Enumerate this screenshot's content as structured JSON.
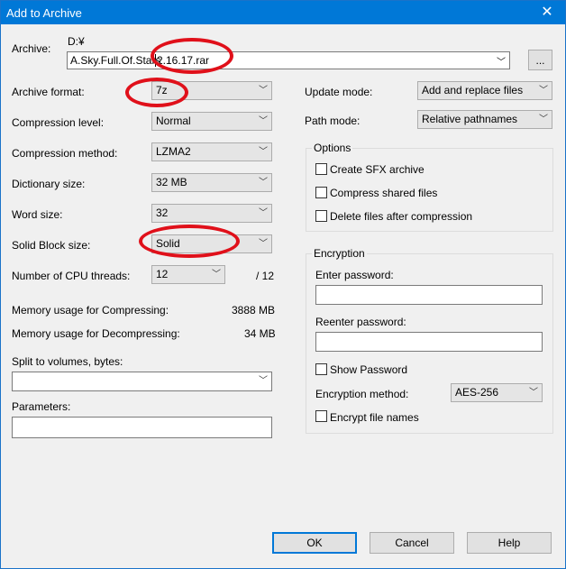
{
  "window": {
    "title": "Add to Archive"
  },
  "archive": {
    "label": "Archive:",
    "dir": "D:¥",
    "name_part1": "A.Sky.Full.Of.Stars",
    "name_part2": "2.16.17.rar",
    "browse_label": "..."
  },
  "left": {
    "format": {
      "label": "Archive format:",
      "value": "7z"
    },
    "level": {
      "label": "Compression level:",
      "value": "Normal"
    },
    "method": {
      "label": "Compression method:",
      "value": "LZMA2"
    },
    "dict": {
      "label": "Dictionary size:",
      "value": "32 MB"
    },
    "word": {
      "label": "Word size:",
      "value": "32"
    },
    "solid": {
      "label": "Solid Block size:",
      "value": "Solid"
    },
    "threads": {
      "label": "Number of CPU threads:",
      "value": "12",
      "max": "/ 12"
    },
    "mem_comp": {
      "label": "Memory usage for Compressing:",
      "value": "3888 MB"
    },
    "mem_decomp": {
      "label": "Memory usage for Decompressing:",
      "value": "34 MB"
    },
    "split": {
      "label": "Split to volumes, bytes:",
      "value": ""
    },
    "params": {
      "label": "Parameters:",
      "value": ""
    }
  },
  "right": {
    "update": {
      "label": "Update mode:",
      "value": "Add and replace files"
    },
    "path": {
      "label": "Path mode:",
      "value": "Relative pathnames"
    },
    "options": {
      "title": "Options",
      "sfx": "Create SFX archive",
      "shared": "Compress shared files",
      "delete": "Delete files after compression"
    },
    "encryption": {
      "title": "Encryption",
      "enter_pw": "Enter password:",
      "reenter_pw": "Reenter password:",
      "show_pw": "Show Password",
      "method_label": "Encryption method:",
      "method_value": "AES-256",
      "encrypt_names": "Encrypt file names"
    }
  },
  "buttons": {
    "ok": "OK",
    "cancel": "Cancel",
    "help": "Help"
  },
  "colors": {
    "titlebar": "#0078d7",
    "annotation": "#e0101a"
  }
}
